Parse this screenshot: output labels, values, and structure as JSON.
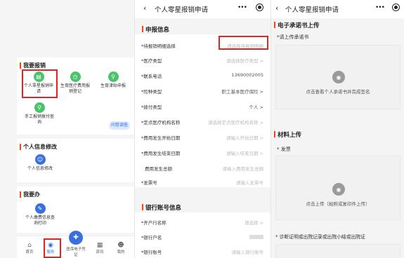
{
  "screen1": {
    "section_report": {
      "title": "我要报销",
      "items": [
        {
          "label": "个人零星报销申请",
          "icon": "document-icon"
        },
        {
          "label": "生育医疗费用报销登记",
          "icon": "clock-icon"
        },
        {
          "label": "生育津贴申报",
          "icon": "search-icon"
        },
        {
          "label": "手工报销拨付查询",
          "icon": "search-icon"
        }
      ],
      "survey_label": "问卷调查"
    },
    "section_info": {
      "title": "个人信息修改",
      "items": [
        {
          "label": "个人信息修改",
          "icon": "person-icon"
        }
      ]
    },
    "section_do": {
      "title": "我要办",
      "items": [
        {
          "label": "个人缴费信息查询打印",
          "icon": "pen-icon"
        }
      ]
    },
    "tabbar": [
      {
        "label": "首页",
        "icon": "home-icon"
      },
      {
        "label": "服务",
        "icon": "compass-icon"
      },
      {
        "label": "医保电子凭证",
        "icon": "medical-card-icon"
      },
      {
        "label": "资讯",
        "icon": "news-icon"
      },
      {
        "label": "我的",
        "icon": "user-icon"
      }
    ]
  },
  "screen2": {
    "nav_title": "个人零星报销申请",
    "declare_title": "申报信息",
    "fields": [
      {
        "label": "*待报销明细选择",
        "value": "请选择待报销明细",
        "filled": false
      },
      {
        "label": "*医疗类型",
        "value": "请选择医疗类型 >",
        "filled": false
      },
      {
        "label": "*联系电话",
        "value": "13690002005",
        "filled": true
      },
      {
        "label": "*险种类型",
        "value": "职工基本医疗保险 >",
        "filled": true
      },
      {
        "label": "*拨付类型",
        "value": "个人 >",
        "filled": true
      },
      {
        "label": "*定点医疗机构名称",
        "value": "请选择定点医疗机构名称 >",
        "filled": false
      },
      {
        "label": "*费用发生开始日期",
        "value": "请输入开始日期 >",
        "filled": false
      },
      {
        "label": "*费用发生结束日期",
        "value": "请输入结束日期 >",
        "filled": false
      },
      {
        "label": "费用发生总额",
        "value": "请输入费用发生总额",
        "filled": false
      },
      {
        "label": "*发票号",
        "value": "请输入发票号",
        "filled": false
      }
    ],
    "bank_title": "银行账号信息",
    "bank_fields": [
      {
        "label": "*开户行名称",
        "value": "请选择 >",
        "filled": false
      },
      {
        "label": "*银行户名",
        "value": "",
        "filled": true
      },
      {
        "label": "*银行账号",
        "value": "请输入银行账号",
        "filled": false
      }
    ]
  },
  "screen3": {
    "nav_title": "个人零星报销申请",
    "sec1_title": "电子承诺书上传",
    "sec1_label": "*请上传承诺书",
    "sec1_caption": "点击查看个人承诺书并完成签名",
    "sec2_title": "材料上传",
    "invoice_label": "* 发票",
    "invoice_caption": "点击上传（拍照或复印件上传）",
    "proof_label": "* 诊断证明或出院记录或出院小结或出院证"
  }
}
